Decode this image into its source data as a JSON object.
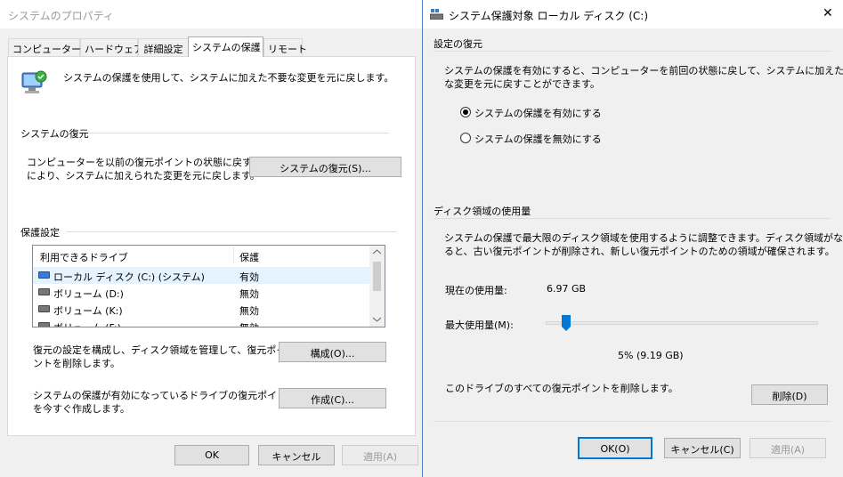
{
  "left_window": {
    "title": "システムのプロパティ",
    "tabs": [
      "コンピューター名",
      "ハードウェア",
      "詳細設定",
      "システムの保護",
      "リモート"
    ],
    "intro_text": "システムの保護を使用して、システムに加えた不要な変更を元に戻します。",
    "restore_group": {
      "title": "システムの復元",
      "desc_line1": "コンピューターを以前の復元ポイントの状態に戻すこと",
      "desc_line2": "により、システムに加えられた変更を元に戻します。",
      "button": "システムの復元(S)..."
    },
    "protection_group": {
      "title": "保護設定",
      "columns": [
        "利用できるドライブ",
        "保護"
      ],
      "rows": [
        {
          "drive": "ローカル ディスク (C:) (システム)",
          "status": "有効"
        },
        {
          "drive": "ボリューム (D:)",
          "status": "無効"
        },
        {
          "drive": "ボリューム (K:)",
          "status": "無効"
        },
        {
          "drive": "ボリューム (F:)",
          "status": "無効"
        }
      ],
      "config_line1": "復元の設定を構成し、ディスク領域を管理して、復元ポイ",
      "config_line2": "ントを削除します。",
      "config_button": "構成(O)...",
      "create_line1": "システムの保護が有効になっているドライブの復元ポイント",
      "create_line2": "を今すぐ作成します。",
      "create_button": "作成(C)..."
    },
    "footer": {
      "ok": "OK",
      "cancel": "キャンセル",
      "apply": "適用(A)"
    }
  },
  "right_window": {
    "title": "システム保護対象 ローカル ディスク (C:)",
    "close": "✕",
    "restore_settings": {
      "title": "設定の復元",
      "desc_line1": "システムの保護を有効にすると、コンピューターを前回の状態に戻して、システムに加えた不要",
      "desc_line2": "な変更を元に戻すことができます。",
      "option_on": "システムの保護を有効にする",
      "option_off": "システムの保護を無効にする",
      "selected": "on"
    },
    "disk_usage": {
      "title": "ディスク領域の使用量",
      "desc_line1": "システムの保護で最大限のディスク領域を使用するように調整できます。ディスク領域がなくな",
      "desc_line2": "ると、古い復元ポイントが削除され、新しい復元ポイントのための領域が確保されます。",
      "current_label": "現在の使用量:",
      "current_value": "6.97 GB",
      "max_label": "最大使用量(M):",
      "slider_percent": 5,
      "slider_readout": "5% (9.19 GB)",
      "delete_text": "このドライブのすべての復元ポイントを削除します。",
      "delete_button": "削除(D)"
    },
    "footer": {
      "ok": "OK(O)",
      "cancel": "キャンセル(C)",
      "apply": "適用(A)"
    }
  },
  "colors": {
    "accent": "#0078d7",
    "selected_row": "#e5f3ff",
    "group_line": "#d5dfe5"
  }
}
